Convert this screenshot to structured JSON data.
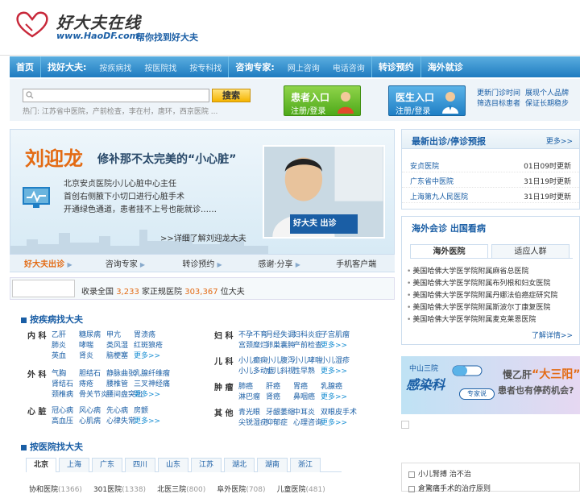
{
  "header": {
    "logo_name": "好大夫在线",
    "logo_url": "www.HaoDF.com",
    "slogan": "帮你找到好大夫"
  },
  "nav": {
    "home": "首页",
    "find": "找好大夫:",
    "by_disease": "按疾病找",
    "by_hospital": "按医院找",
    "by_dept": "按专科找",
    "consult": "咨询专家:",
    "online": "网上咨询",
    "phone": "电话咨询",
    "transfer": "转诊预约",
    "overseas": "海外就诊"
  },
  "search": {
    "placeholder": "",
    "button": "搜索",
    "hot": "热门: 江苏省中医院，产前检查，李在村，唐环，西京医院 ..."
  },
  "patient": {
    "title": "患者入口",
    "sub": "注册/登录"
  },
  "doctor": {
    "title": "医生入口",
    "sub": "注册/登录"
  },
  "quick_links": [
    "更新门诊时间",
    "展现个人品牌",
    "筛选目标患者",
    "保证长期稳步"
  ],
  "banner": {
    "doctor_name": "刘迎龙",
    "slogan": "修补那不太完美的“小心脏”",
    "info1": "北京安贞医院小儿心脏中心主任",
    "info2": "首创右侧腋下小切口进行心脏手术",
    "info3": "开通绿色通道，患者挂不上号也能就诊……",
    "more": ">>详细了解刘迎龙大夫",
    "photo_logo": "好大夫 出诊"
  },
  "banner_tabs": [
    "好大夫出诊",
    "咨询专家",
    "转诊预约",
    "感谢·分享",
    "手机客户端"
  ],
  "stats": {
    "prefix": "收录全国",
    "hospitals": "3,233",
    "mid": "家正规医院",
    "doctors": "303,367",
    "suffix": "位大夫"
  },
  "disease": {
    "title": "按疾病找大夫",
    "cats": [
      {
        "name": "内 科",
        "items": [
          "乙肝",
          "糖尿病",
          "甲亢",
          "胃溃疡",
          "肺炎",
          "哮喘",
          "类风湿",
          "红斑狼疮",
          "英血",
          "肾炎",
          "脑梗塞",
          "更多>>"
        ]
      },
      {
        "name": "外 科",
        "items": [
          "气胸",
          "胆结石",
          "静脉曲张",
          "乳腺纤维瘤",
          "肾结石",
          "痔疮",
          "腰椎管",
          "三叉神经痛",
          "颈椎病",
          "骨关节炎",
          "腰间盘突出",
          "更多>>"
        ]
      },
      {
        "name": "心 脏",
        "items": [
          "冠心病",
          "风心病",
          "先心病",
          "房颤",
          "高血压",
          "心肌病",
          "心律失常",
          "更多>>"
        ]
      },
      {
        "name": "妇 科",
        "items": [
          "不孕不育",
          "月经失调",
          "妇科炎症",
          "子宫肌瘤",
          "宫颈糜烂",
          "卵巢囊肿",
          "产前检查",
          "更多>>"
        ]
      },
      {
        "name": "儿 科",
        "items": [
          "小儿癫痫",
          "小儿腹泻",
          "小儿哮喘",
          "小儿湿疹",
          "小儿多动症",
          "小儿斜视",
          "性早熟",
          "更多>>"
        ]
      },
      {
        "name": "肿 瘤",
        "items": [
          "肺癌",
          "肝癌",
          "胃癌",
          "乳腺癌",
          "淋巴瘤",
          "肾癌",
          "鼻咽癌",
          "更多>>"
        ]
      },
      {
        "name": "其 他",
        "items": [
          "青光眼",
          "牙龈萎缩",
          "中耳炎",
          "双眼皮手术",
          "尖锐湿疣",
          "抑郁症",
          "心理咨询",
          "更多>>"
        ]
      }
    ]
  },
  "hospital": {
    "title": "按医院找大夫",
    "tabs": [
      "北京",
      "上海",
      "广东",
      "四川",
      "山东",
      "江苏",
      "湖北",
      "湖南",
      "浙江"
    ],
    "row": [
      {
        "n": "协和医院",
        "c": "(1366)"
      },
      {
        "n": "301医院",
        "c": "(1338)"
      },
      {
        "n": "北医三院",
        "c": "(800)"
      },
      {
        "n": "阜外医院",
        "c": "(708)"
      },
      {
        "n": "儿童医院",
        "c": "(481)"
      }
    ]
  },
  "right1": {
    "title": "最新出诊/停诊预报",
    "more": "更多>>",
    "rows": [
      {
        "h": "安贞医院",
        "t": "01日09时更新"
      },
      {
        "h": "广东省中医院",
        "t": "31日19时更新"
      },
      {
        "h": "上海第九人民医院",
        "t": "31日19时更新"
      }
    ]
  },
  "right2": {
    "title": "海外会诊 出国看病",
    "tabs": [
      "海外医院",
      "适应人群"
    ],
    "items": [
      "美国哈佛大学医学院附属麻省总医院",
      "美国哈佛大学医学院附属布列根和妇女医院",
      "美国哈佛大学医学院附属丹娜法伯癌症研究院",
      "美国哈佛大学医学院附属斯波尔丁康复医院",
      "美国哈佛大学医学院附属麦克莱恩医院"
    ],
    "more": "了解详情>>"
  },
  "ad": {
    "hospital": "中山三院",
    "title": "感染科",
    "badge": "专家说",
    "l1a": "慢乙肝",
    "l1b": "“大三阳”",
    "l2": "患者也有停药机会?"
  },
  "right3": {
    "items": [
      "小儿腎搏 治不治",
      "倉驚痛手术的治疗原则"
    ]
  }
}
